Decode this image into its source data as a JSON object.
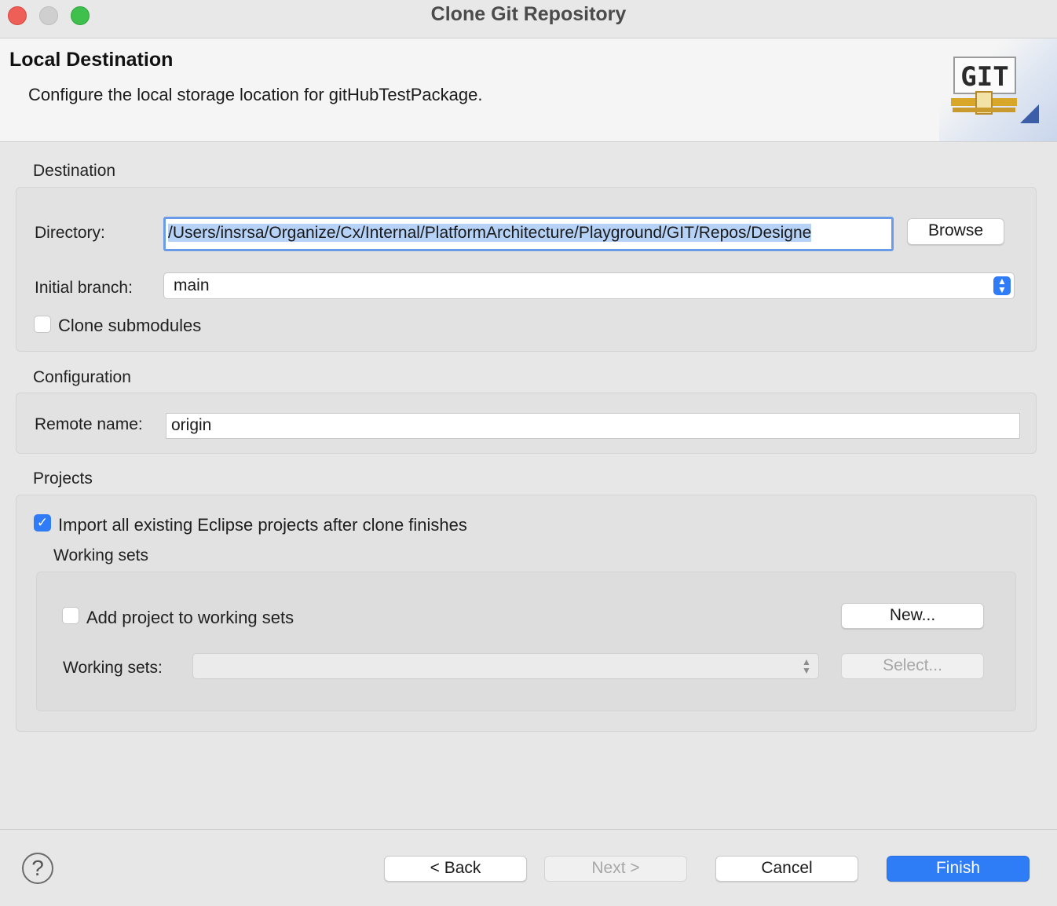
{
  "window": {
    "title": "Clone Git Repository"
  },
  "banner": {
    "title": "Local Destination",
    "description": "Configure the local storage location for gitHubTestPackage.",
    "logo_text": "GIT"
  },
  "destination": {
    "section_label": "Destination",
    "directory_label": "Directory:",
    "directory_value": "/Users/insrsa/Organize/Cx/Internal/PlatformArchitecture/Playground/GIT/Repos/Designe",
    "browse_label": "Browse",
    "branch_label": "Initial branch:",
    "branch_value": "main",
    "clone_submodules_label": "Clone submodules",
    "clone_submodules_checked": false
  },
  "configuration": {
    "section_label": "Configuration",
    "remote_label": "Remote name:",
    "remote_value": "origin"
  },
  "projects": {
    "section_label": "Projects",
    "import_label": "Import all existing Eclipse projects after clone finishes",
    "import_checked": true,
    "working_sets_heading": "Working sets",
    "add_to_working_sets_label": "Add project to working sets",
    "add_to_working_sets_checked": false,
    "new_button": "New...",
    "working_sets_label": "Working sets:",
    "working_sets_value": "",
    "select_button": "Select..."
  },
  "footer": {
    "help_icon": "?",
    "back": "< Back",
    "next": "Next >",
    "cancel": "Cancel",
    "finish": "Finish"
  },
  "colors": {
    "accent": "#2f7cf6",
    "window_bg": "#e7e7e7"
  }
}
